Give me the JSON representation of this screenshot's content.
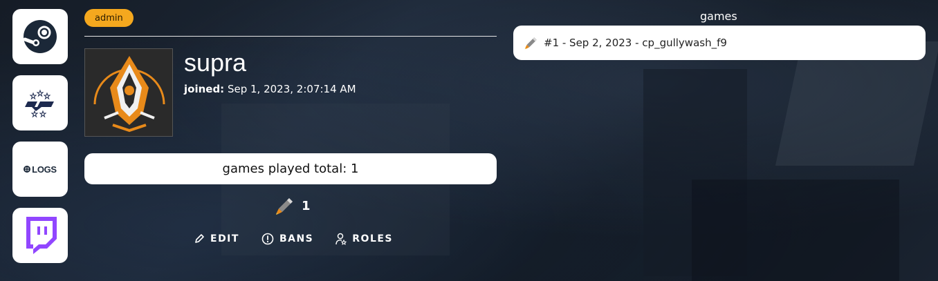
{
  "sidebar": {
    "items": [
      {
        "name": "steam",
        "icon": "steam-icon"
      },
      {
        "name": "etf2l",
        "icon": "etf2l-icon"
      },
      {
        "name": "logs",
        "label": "LOGS",
        "icon": "logs-icon"
      },
      {
        "name": "twitch",
        "icon": "twitch-icon"
      }
    ]
  },
  "profile": {
    "role_badge": "admin",
    "username": "supra",
    "joined_label": "joined:",
    "joined_value": "Sep 1, 2023, 2:07:14 AM",
    "avatar_icon": "player-avatar-icon"
  },
  "stats": {
    "games_played_total": "games played total: 1",
    "class_icon": "soldier-rocket-icon",
    "class_count": "1"
  },
  "actions": [
    {
      "label": "EDIT",
      "icon": "pencil-icon"
    },
    {
      "label": "BANS",
      "icon": "alert-circle-icon"
    },
    {
      "label": "ROLES",
      "icon": "user-role-icon"
    }
  ],
  "games": {
    "title": "games",
    "items": [
      {
        "label": "#1 - Sep 2, 2023 - cp_gullywash_f9",
        "icon": "soldier-rocket-icon"
      }
    ]
  },
  "colors": {
    "badge": "#f5a81e",
    "twitch": "#9146ff",
    "steam": "#1b2838"
  }
}
